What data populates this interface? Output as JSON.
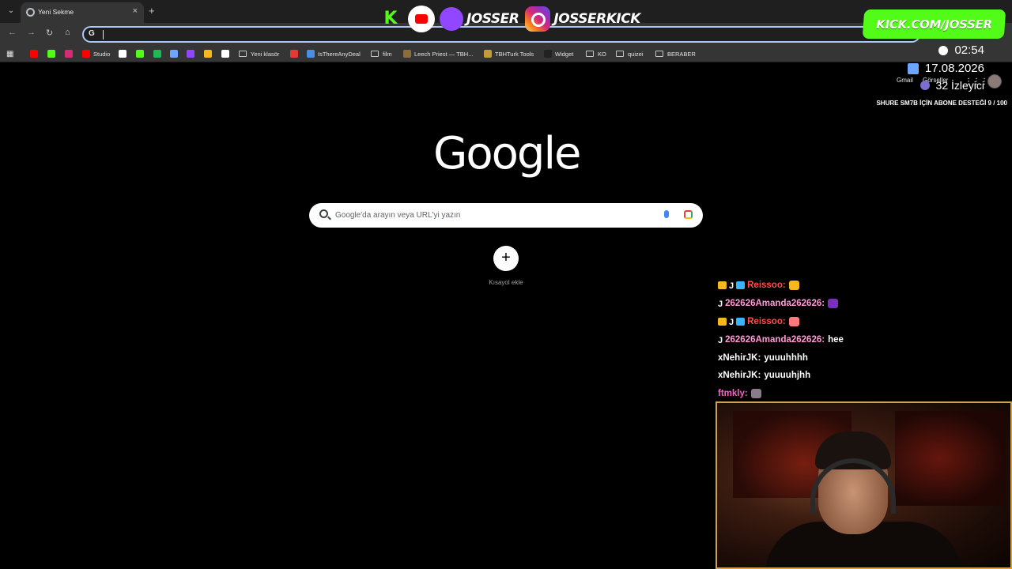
{
  "browser": {
    "tab_title": "Yeni Sekme",
    "tab_close": "×",
    "new_tab": "+",
    "tab_menu": "⌄",
    "back": "←",
    "forward": "→",
    "reload": "↻",
    "home": "⌂",
    "omnibox_glyph": "G",
    "bookmarks": [
      {
        "label": "",
        "icon": "youtube-icon",
        "color": "#ff0000"
      },
      {
        "label": "",
        "icon": "kick-icon",
        "color": "#53fc18"
      },
      {
        "label": "",
        "icon": "instagram-icon",
        "color": "#d62976"
      },
      {
        "label": "Studio",
        "icon": "youtube-studio-icon",
        "color": "#ff0000"
      },
      {
        "label": "",
        "icon": "tiktok-icon",
        "color": "#ffffff"
      },
      {
        "label": "",
        "icon": "kick-icon",
        "color": "#53fc18"
      },
      {
        "label": "",
        "icon": "spotify-icon",
        "color": "#1db954"
      },
      {
        "label": "",
        "icon": "link-icon",
        "color": "#6ea6ff"
      },
      {
        "label": "",
        "icon": "twitch-icon",
        "color": "#9146ff"
      },
      {
        "label": "",
        "icon": "misc-icon",
        "color": "#f6b81a"
      },
      {
        "label": "",
        "icon": "diamond-icon",
        "color": "#ffffff"
      },
      {
        "label": "Yeni klasör",
        "icon": "folder-icon",
        "color": "#c4c7c5"
      },
      {
        "label": "",
        "icon": "red-icon",
        "color": "#e53935"
      },
      {
        "label": "IsThereAnyDeal",
        "icon": "deal-icon",
        "color": "#4a90e2"
      },
      {
        "label": "film",
        "icon": "folder-icon",
        "color": "#c4c7c5"
      },
      {
        "label": "Leech Priest — TBH...",
        "icon": "tbh-icon",
        "color": "#8a6d3b"
      },
      {
        "label": "TBHTurk Tools",
        "icon": "tbh-icon",
        "color": "#c49a3a"
      },
      {
        "label": "Widget",
        "icon": "widget-icon",
        "color": "#222222"
      },
      {
        "label": "KO",
        "icon": "folder-icon",
        "color": "#c4c7c5"
      },
      {
        "label": "quizei",
        "icon": "folder-icon",
        "color": "#c4c7c5"
      },
      {
        "label": "BERABER",
        "icon": "folder-icon",
        "color": "#c4c7c5"
      }
    ]
  },
  "page": {
    "logo": "Google",
    "search_placeholder": "Google'da arayın veya URL'yi yazın",
    "shortcut_plus": "+",
    "shortcut_label": "Kısayol ekle",
    "gmail": "Gmail",
    "images": "Görseller",
    "apps": "⋮⋮⋮"
  },
  "overlay": {
    "kick_logo": "K",
    "handle_twitch": "JOSSER",
    "handle_kick": "JOSSERKICK",
    "banner": "KICK.COM/JOSSER",
    "time": "02:54",
    "date": "17.08.2026",
    "viewers": "32 İzleyici",
    "sub_goal": "SHURE SM7B İÇİN ABONE DESTEĞİ 9 / 100"
  },
  "chat": [
    {
      "user": "Reissoo:",
      "color": "#ff4d4d",
      "badges": [
        "crown",
        "j",
        "cube"
      ],
      "msg": "",
      "emote": "#f6b81a"
    },
    {
      "user": "262626Amanda262626:",
      "color": "#ff9ad5",
      "badges": [
        "j"
      ],
      "msg": "",
      "emote": "#7b2fbf"
    },
    {
      "user": "Reissoo:",
      "color": "#ff4d4d",
      "badges": [
        "crown",
        "j",
        "cube"
      ],
      "msg": "",
      "emote": "#ff7b7b"
    },
    {
      "user": "262626Amanda262626:",
      "color": "#ff9ad5",
      "badges": [
        "j"
      ],
      "msg": "hee",
      "emote": ""
    },
    {
      "user": "xNehirJK:",
      "color": "#ffffff",
      "badges": [],
      "msg": "yuuuhhhh",
      "emote": ""
    },
    {
      "user": "xNehirJK:",
      "color": "#ffffff",
      "badges": [],
      "msg": "yuuuuhjhh",
      "emote": ""
    },
    {
      "user": "ftmkly:",
      "color": "#ff5ec8",
      "badges": [],
      "msg": "",
      "emote": "#8a7a8a"
    }
  ]
}
